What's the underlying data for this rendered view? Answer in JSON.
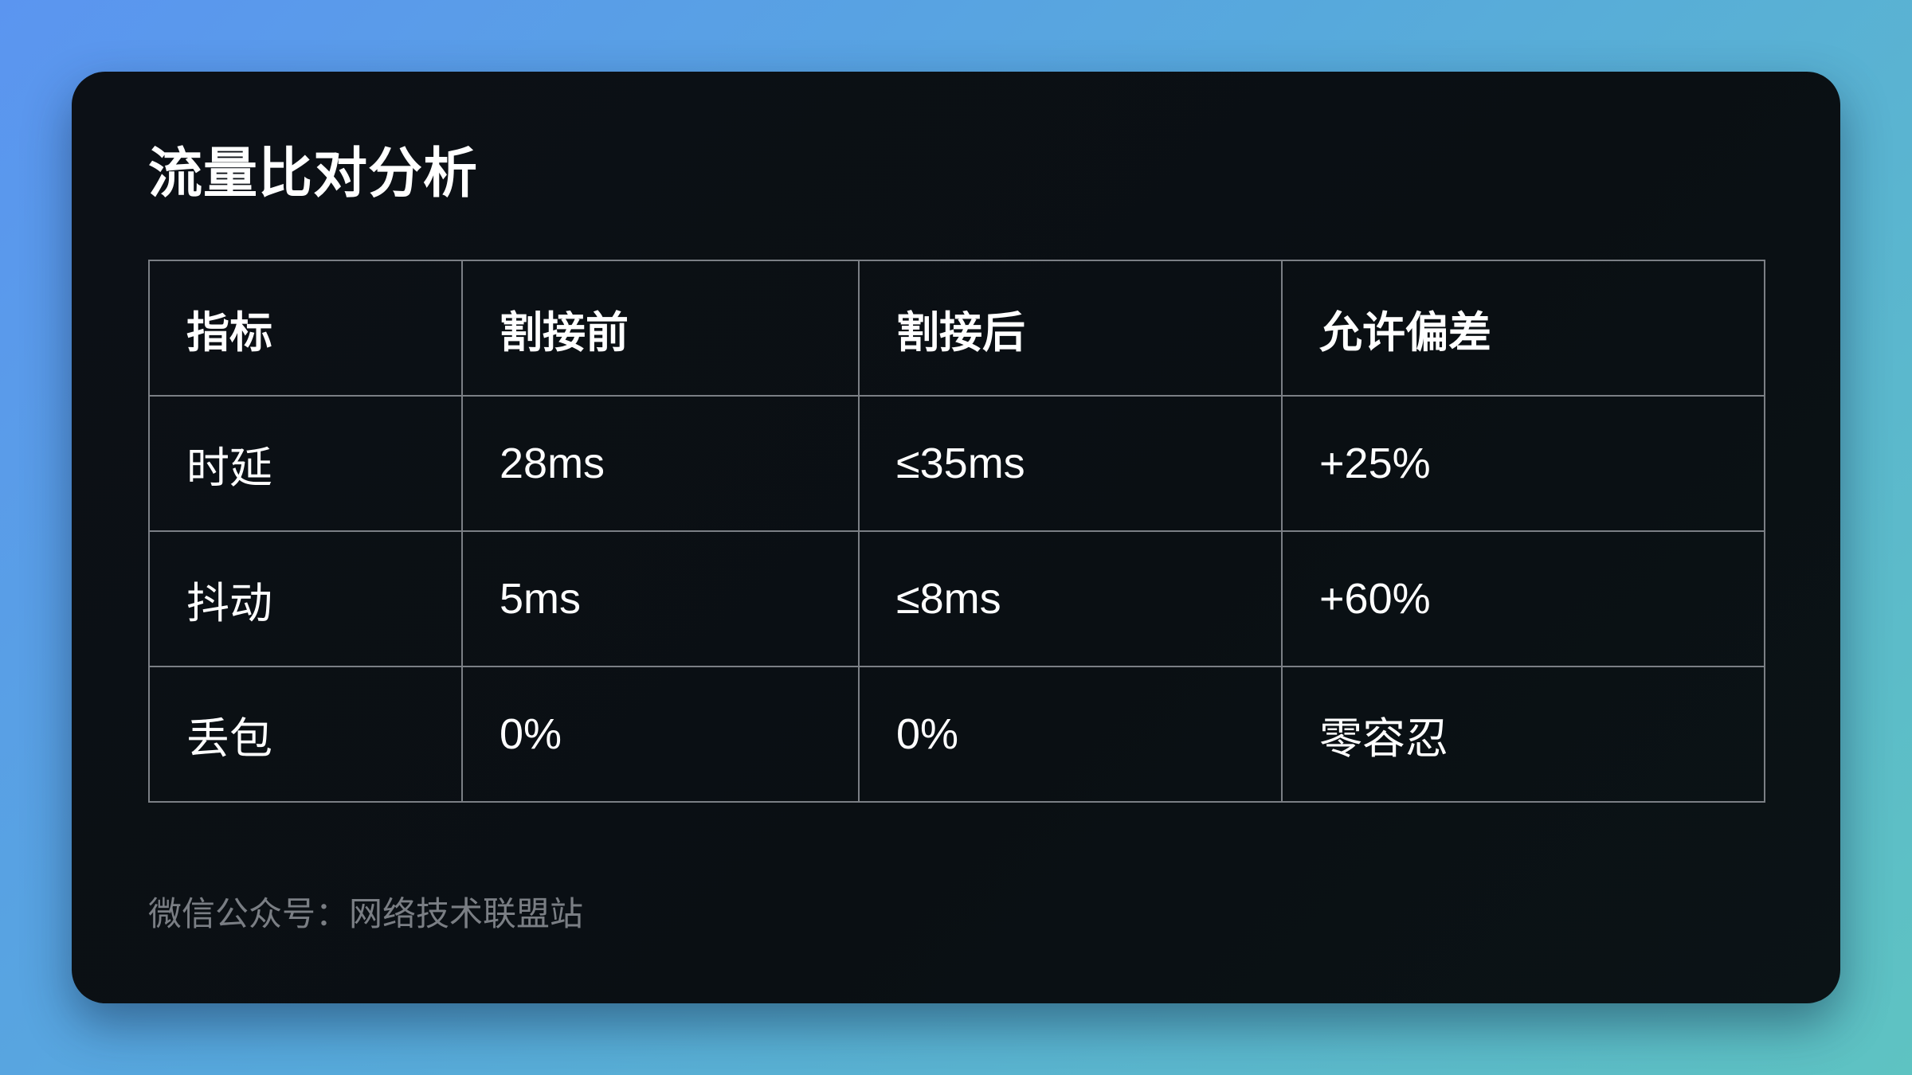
{
  "title": "流量比对分析",
  "table": {
    "headers": [
      "指标",
      "割接前",
      "割接后",
      "允许偏差"
    ],
    "rows": [
      [
        "时延",
        "28ms",
        "≤35ms",
        "+25%"
      ],
      [
        "抖动",
        "5ms",
        "≤8ms",
        "+60%"
      ],
      [
        "丢包",
        "0%",
        "0%",
        "零容忍"
      ]
    ]
  },
  "footer": "微信公众号：网络技术联盟站",
  "colors": {
    "background_start": "#5b95f0",
    "background_end": "#5ec3c2",
    "card": "#0b1015",
    "text": "#ffffff",
    "border": "#7b7f85",
    "muted": "#7a7e84"
  }
}
